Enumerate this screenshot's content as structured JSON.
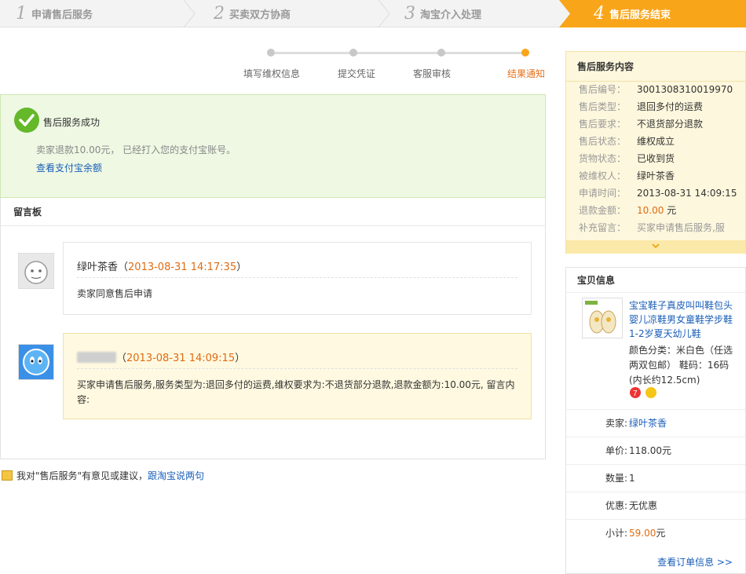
{
  "steps": [
    {
      "num": "1",
      "label": "申请售后服务"
    },
    {
      "num": "2",
      "label": "买卖双方协商"
    },
    {
      "num": "3",
      "label": "淘宝介入处理"
    },
    {
      "num": "4",
      "label": "售后服务结束"
    }
  ],
  "progress": {
    "labels": [
      "填写维权信息",
      "提交凭证",
      "客服审核",
      "结果通知"
    ]
  },
  "success": {
    "title": "售后服务成功",
    "desc": "卖家退款10.00元， 已经打入您的支付宝账号。",
    "link": "查看支付宝余额"
  },
  "board": {
    "title": "留言板",
    "messages": [
      {
        "name": "绿叶茶香",
        "time": "2013-08-31 14:17:35",
        "body": "卖家同意售后申请"
      },
      {
        "name": "",
        "time": "2013-08-31 14:09:15",
        "body": "买家申请售后服务,服务类型为:退回多付的运费,维权要求为:不退货部分退款,退款金额为:10.00元, 留言内容:"
      }
    ]
  },
  "feedback": {
    "text": "我对\"售后服务\"有意见或建议，",
    "link": "跟淘宝说两句"
  },
  "service": {
    "title": "售后服务内容",
    "rows": [
      {
        "k": "售后编号：",
        "v": "3001308310019970"
      },
      {
        "k": "售后类型：",
        "v": "退回多付的运费"
      },
      {
        "k": "售后要求：",
        "v": "不退货部分退款"
      },
      {
        "k": "售后状态：",
        "v": "维权成立"
      },
      {
        "k": "货物状态：",
        "v": "已收到货"
      },
      {
        "k": "被维权人：",
        "v": "绿叶茶香"
      },
      {
        "k": "申请时间：",
        "v": "2013-08-31 14:09:15"
      },
      {
        "k": "退款金额：",
        "v": "10.00",
        "unit": "元"
      },
      {
        "k": "补充留言：",
        "v": "买家申请售后服务,服"
      }
    ]
  },
  "product": {
    "title": "宝贝信息",
    "name": "宝宝鞋子真皮叫叫鞋包头婴儿凉鞋男女童鞋学步鞋1-2岁夏天幼儿鞋",
    "spec": "颜色分类：米白色（任选两双包邮） 鞋码：16码(内长约12.5cm)",
    "rows": [
      {
        "k": "卖家:",
        "v": "绿叶茶香"
      },
      {
        "k": "单价:",
        "v": "118.00元"
      },
      {
        "k": "数量:",
        "v": "1"
      },
      {
        "k": "优惠:",
        "v": "无优惠"
      },
      {
        "k": "小计:",
        "v": "59.00",
        "unit": "元"
      }
    ],
    "order_link": "查看订单信息 >>"
  }
}
